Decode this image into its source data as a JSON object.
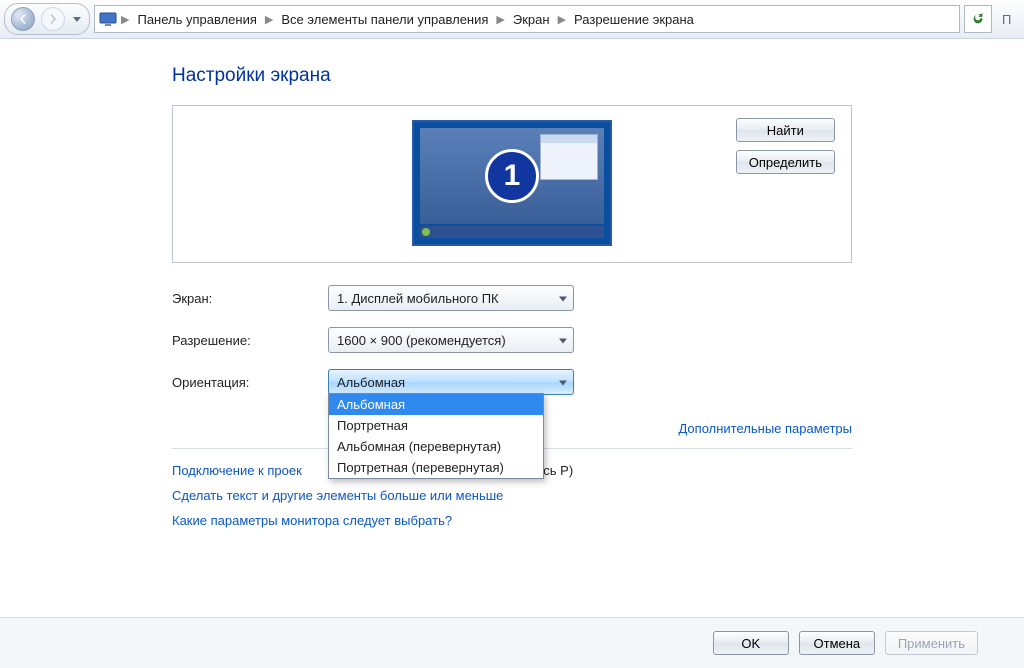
{
  "breadcrumb": {
    "items": [
      "Панель управления",
      "Все элементы панели управления",
      "Экран",
      "Разрешение экрана"
    ]
  },
  "search_stub": "П",
  "title": "Настройки экрана",
  "buttons": {
    "find": "Найти",
    "identify": "Определить",
    "ok": "OK",
    "cancel": "Отмена",
    "apply": "Применить"
  },
  "monitor_number": "1",
  "form": {
    "display_label": "Экран:",
    "display_value": "1. Дисплей мобильного ПК",
    "resolution_label": "Разрешение:",
    "resolution_value": "1600 × 900 (рекомендуется)",
    "orientation_label": "Ориентация:",
    "orientation_value": "Альбомная",
    "orientation_options": [
      "Альбомная",
      "Портретная",
      "Альбомная (перевернутая)",
      "Портретная (перевернутая)"
    ]
  },
  "links": {
    "advanced": "Дополнительные параметры",
    "projector_prefix": "Подключение к проек",
    "projector_suffix": " и коснитесь P)",
    "textsize": "Сделать текст и другие элементы больше или меньше",
    "which": "Какие параметры монитора следует выбрать?"
  }
}
